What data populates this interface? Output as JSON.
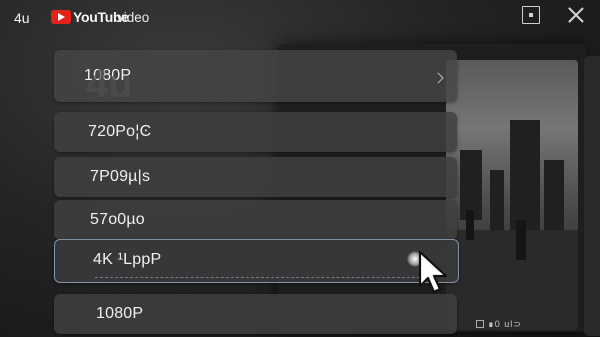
{
  "header": {
    "brand": "4u",
    "logo_word": "YouTube",
    "subtitle": "video"
  },
  "watermark": "4u",
  "quality_menu": {
    "items": [
      {
        "label": "1080P"
      },
      {
        "label": "720Po¦Ͼ"
      },
      {
        "label": "7P09µ|s"
      },
      {
        "label": "57o0µo"
      },
      {
        "label": "4K ¹LppP"
      },
      {
        "label": "1080P"
      }
    ],
    "selected_index": 4
  },
  "player": {
    "badge_text": "∎0 ul⊃"
  },
  "colors": {
    "accent": "#7f92a8",
    "youtube_red": "#e62117"
  },
  "icons": [
    "pip-icon",
    "close-icon",
    "chevron-right-icon",
    "spark-icon",
    "cursor-icon",
    "youtube-logo-icon"
  ]
}
